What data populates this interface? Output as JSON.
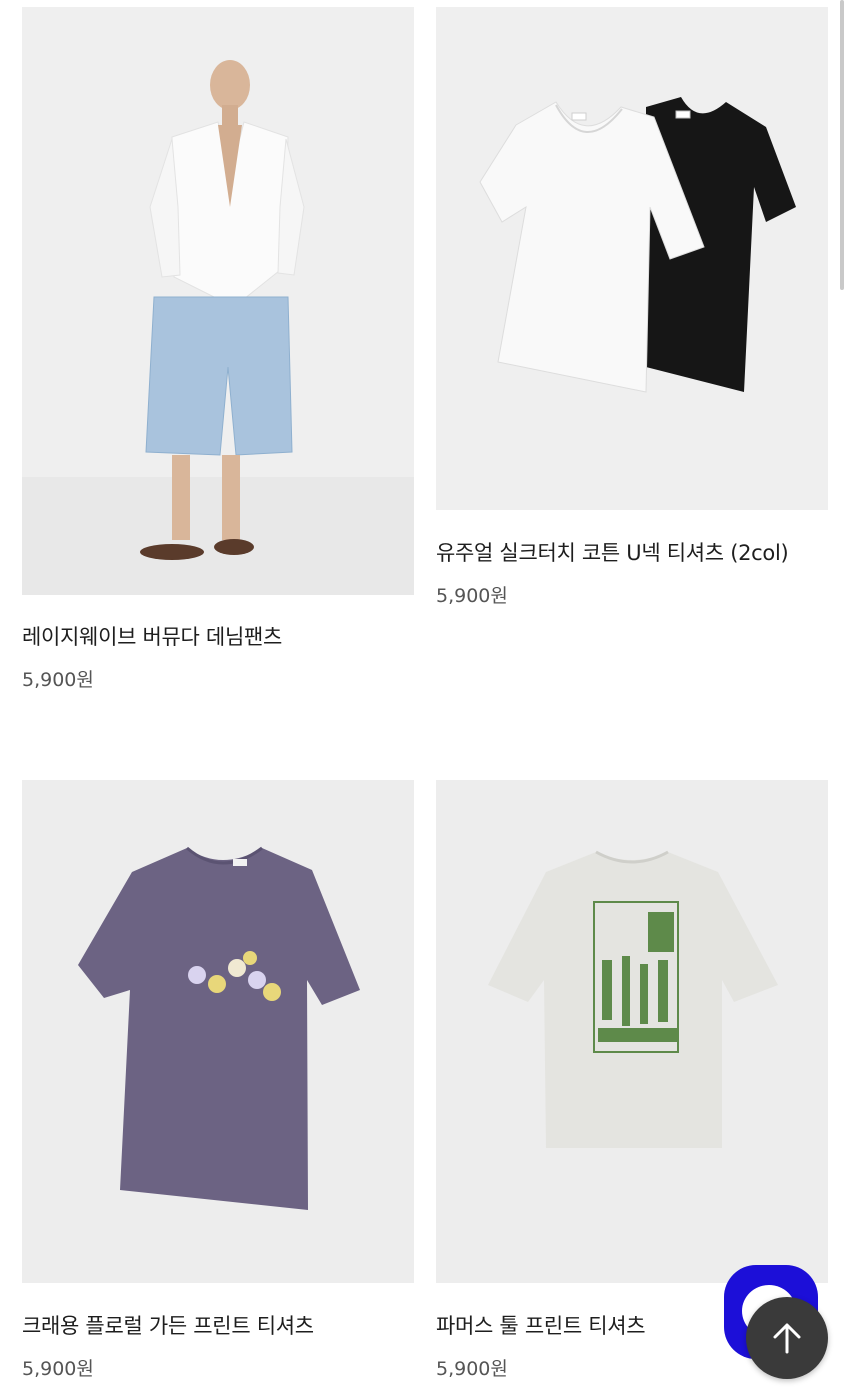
{
  "products": [
    {
      "name": "레이지웨이브 버뮤다 데님팬츠",
      "price": "5,900원",
      "image": "model-denim-shorts"
    },
    {
      "name": "유주얼 실크터치 코튼 U넥 티셔츠 (2col)",
      "price": "5,900원",
      "image": "white-black-tshirts"
    },
    {
      "name": "크래용 플로럴 가든 프린트 티셔츠",
      "price": "5,900원",
      "image": "purple-floral-tshirt"
    },
    {
      "name": "파머스 툴 프린트 티셔츠",
      "price": "5,900원",
      "image": "gray-garden-tool-tshirt"
    }
  ],
  "floating": {
    "chat_icon": "chat-bubble-icon",
    "scroll_top_icon": "arrow-up-icon"
  },
  "colors": {
    "chat_button": "#1c0fd8",
    "top_button": "#3a3a3a"
  }
}
